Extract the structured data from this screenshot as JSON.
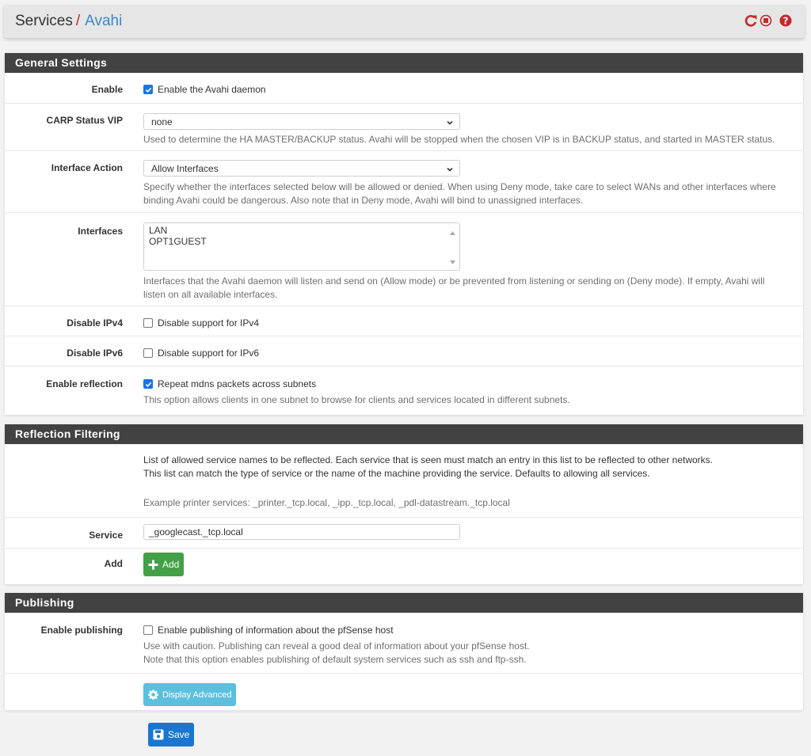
{
  "breadcrumb": {
    "parent": "Services",
    "separator": "/",
    "current": "Avahi",
    "icons": [
      "restart-service-icon",
      "stop-service-icon",
      "help-icon"
    ]
  },
  "colors": {
    "panel_heading_bg": "#424242",
    "link": "#3a87c8",
    "icon_red": "#c62828",
    "checkbox_blue": "#1a73e8",
    "add_green": "#43a047",
    "info_blue": "#5bc0de",
    "save_blue": "#1976d2"
  },
  "general": {
    "title": "General Settings",
    "enable": {
      "label": "Enable",
      "checkbox_label": "Enable the Avahi daemon",
      "checked": true
    },
    "carp": {
      "label": "CARP Status VIP",
      "value": "none",
      "help": "Used to determine the HA MASTER/BACKUP status. Avahi will be stopped when the chosen VIP is in BACKUP status, and started in MASTER status."
    },
    "interface_action": {
      "label": "Interface Action",
      "value": "Allow Interfaces",
      "help_line1": "Specify whether the interfaces selected below will be allowed or denied. When using Deny mode, take care to select WANs and other interfaces where",
      "help_line2": "binding Avahi could be dangerous. Also note that in Deny mode, Avahi will bind to unassigned interfaces."
    },
    "interfaces": {
      "label": "Interfaces",
      "options": [
        "LAN",
        "OPT1GUEST"
      ],
      "help_line1": "Interfaces that the Avahi daemon will listen and send on (Allow mode) or be prevented from listening or sending on (Deny mode). If empty, Avahi will",
      "help_line2": "listen on all available interfaces."
    },
    "disable_ipv4": {
      "label": "Disable IPv4",
      "checkbox_label": "Disable support for IPv4",
      "checked": false
    },
    "disable_ipv6": {
      "label": "Disable IPv6",
      "checkbox_label": "Disable support for IPv6",
      "checked": false
    },
    "reflection": {
      "label": "Enable reflection",
      "checkbox_label": "Repeat mdns packets across subnets",
      "checked": true,
      "help": "This option allows clients in one subnet to browse for clients and services located in different subnets."
    }
  },
  "reflection_filtering": {
    "title": "Reflection Filtering",
    "desc_line1": "List of allowed service names to be reflected. Each service that is seen must match an entry in this list to be reflected to other networks.",
    "desc_line2": "This list can match the type of service or the name of the machine providing the service. Defaults to allowing all services.",
    "example": "Example printer services: _printer._tcp.local, _ipp._tcp.local, _pdl-datastream._tcp.local",
    "service": {
      "label": "Service",
      "value": "_googlecast._tcp.local"
    },
    "add": {
      "label": "Add",
      "button": "Add"
    }
  },
  "publishing": {
    "title": "Publishing",
    "enable": {
      "label": "Enable publishing",
      "checkbox_label": "Enable publishing of information about the pfSense host",
      "checked": false,
      "help_line1": "Use with caution. Publishing can reveal a good deal of information about your pfSense host.",
      "help_line2": "Note that this option enables publishing of default system services such as ssh and ftp-ssh."
    },
    "advanced_button": "Display Advanced"
  },
  "save_button": "Save"
}
